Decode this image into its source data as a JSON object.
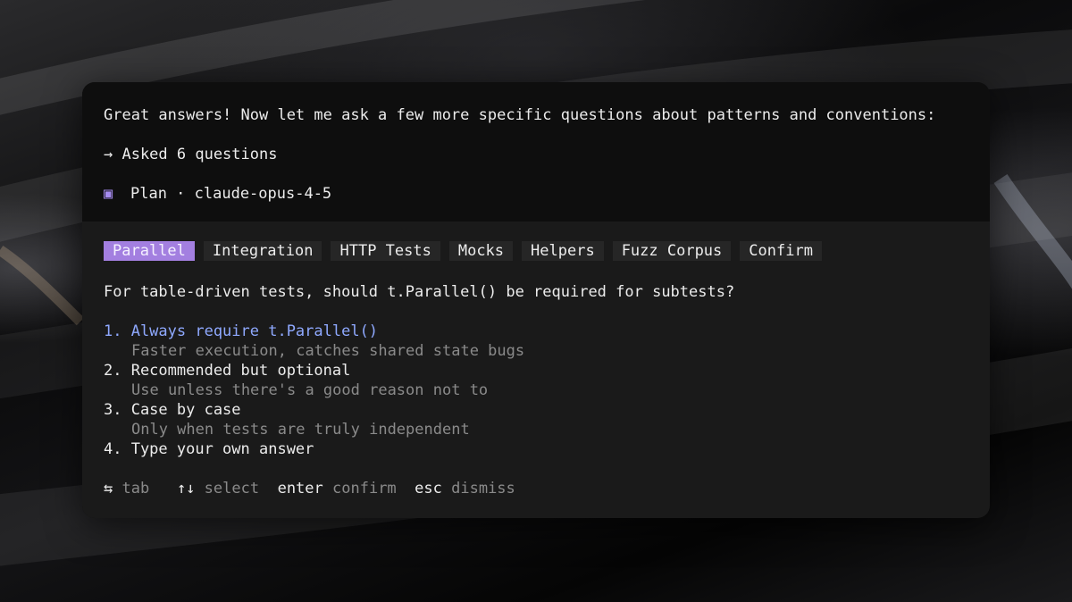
{
  "header": {
    "intro_text": "Great answers! Now let me ask a few more specific questions about patterns and conventions:",
    "asked_text": "→ Asked 6 questions",
    "plan_icon": "square-icon",
    "plan_text": "Plan · claude-opus-4-5"
  },
  "tabs": [
    {
      "label": "Parallel",
      "active": true
    },
    {
      "label": "Integration",
      "active": false
    },
    {
      "label": "HTTP Tests",
      "active": false
    },
    {
      "label": "Mocks",
      "active": false
    },
    {
      "label": "Helpers",
      "active": false
    },
    {
      "label": "Fuzz Corpus",
      "active": false
    },
    {
      "label": "Confirm",
      "active": false
    }
  ],
  "question": "For table-driven tests, should t.Parallel() be required for subtests?",
  "options": [
    {
      "label": "1. Always require t.Parallel()",
      "description": "Faster execution, catches shared state bugs",
      "selected": true
    },
    {
      "label": "2. Recommended but optional",
      "description": "Use unless there's a good reason not to",
      "selected": false
    },
    {
      "label": "3. Case by case",
      "description": "Only when tests are truly independent",
      "selected": false
    },
    {
      "label": "4. Type your own answer",
      "description": "",
      "selected": false
    }
  ],
  "hints": {
    "tab_key": "⇆",
    "tab_label": "tab",
    "select_key": "↑↓",
    "select_label": "select",
    "enter_key": "enter",
    "enter_label": "confirm",
    "esc_key": "esc",
    "esc_label": "dismiss"
  },
  "colors": {
    "accent": "#8fa9ff",
    "tab_active": "#a37fe0",
    "plan_icon": "#a68cf0"
  }
}
